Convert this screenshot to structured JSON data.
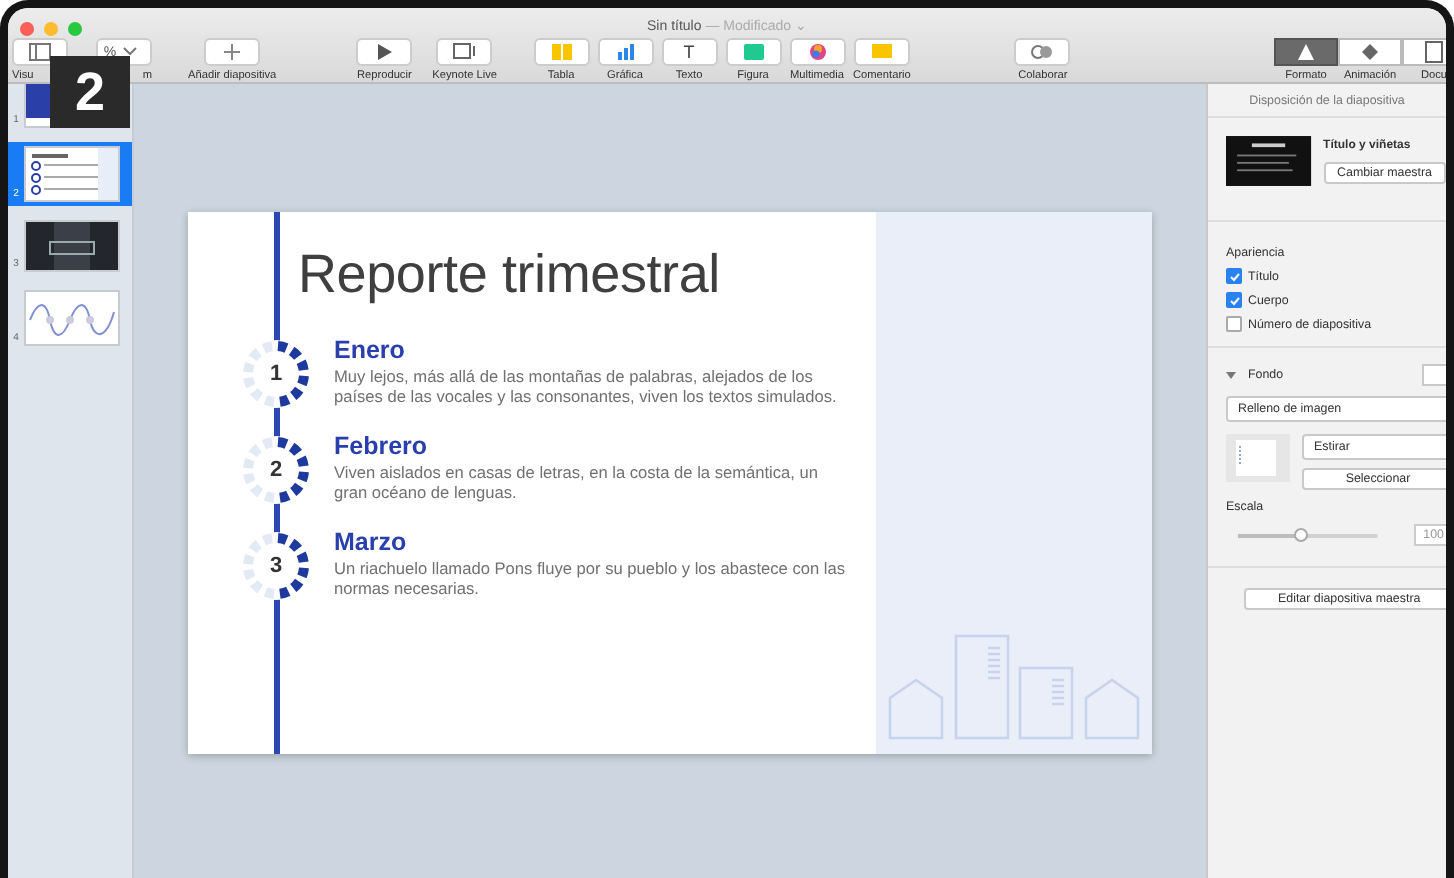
{
  "window": {
    "title": "Sin título",
    "status": "— Modificado ⌄"
  },
  "step_badge": "2",
  "toolbar": {
    "groups": [
      {
        "items": [
          {
            "kind": "view",
            "label": "Visu"
          },
          {
            "kind": "zoom",
            "label": "m",
            "value": "%"
          },
          {
            "kind": "add",
            "label": "Añadir diapositiva"
          }
        ]
      },
      {
        "items": [
          {
            "kind": "play",
            "label": "Reproducir"
          },
          {
            "kind": "live",
            "label": "Keynote Live"
          }
        ]
      },
      {
        "items": [
          {
            "kind": "table",
            "label": "Tabla"
          },
          {
            "kind": "chart",
            "label": "Gráfica"
          },
          {
            "kind": "text",
            "label": "Texto",
            "glyph": "T"
          },
          {
            "kind": "shape",
            "label": "Figura"
          },
          {
            "kind": "media",
            "label": "Multimedia"
          },
          {
            "kind": "comment",
            "label": "Comentario"
          }
        ]
      },
      {
        "items": [
          {
            "kind": "collab",
            "label": "Colaborar"
          }
        ]
      }
    ],
    "tabs": [
      {
        "kind": "format",
        "label": "Formato",
        "selected": true
      },
      {
        "kind": "animate",
        "label": "Animación",
        "selected": false
      },
      {
        "kind": "document",
        "label": "Docu",
        "selected": false
      }
    ]
  },
  "navigator": {
    "slides": [
      {
        "number": "1",
        "kind": "title",
        "selected": false
      },
      {
        "number": "2",
        "kind": "bullets",
        "selected": true
      },
      {
        "number": "3",
        "kind": "photo",
        "selected": false
      },
      {
        "number": "4",
        "kind": "wave",
        "selected": false
      }
    ]
  },
  "slide": {
    "title": "Reporte trimestral",
    "items": [
      {
        "number": "1",
        "heading": "Enero",
        "body": "Muy lejos, más allá de las montañas de palabras, alejados de los países de las vocales y las consonantes, viven los textos simulados."
      },
      {
        "number": "2",
        "heading": "Febrero",
        "body": "Viven aislados en casas de letras, en la costa de la semántica, un gran océano de lenguas."
      },
      {
        "number": "3",
        "heading": "Marzo",
        "body": "Un riachuelo llamado Pons fluye por su pueblo y los abastece con las normas necesarias."
      }
    ]
  },
  "inspector": {
    "header": "Disposición de la diapositiva",
    "master": {
      "name": "Título y viñetas",
      "button": "Cambiar maestra"
    },
    "appearance": {
      "label": "Apariencia",
      "checks": [
        {
          "label": "Título",
          "checked": true
        },
        {
          "label": "Cuerpo",
          "checked": true
        },
        {
          "label": "Número de diapositiva",
          "checked": false
        }
      ]
    },
    "background": {
      "label": "Fondo",
      "expanded": true,
      "fill": "Relleno de imagen",
      "mode": "Estirar",
      "choose": "Seleccionar",
      "scale": {
        "label": "Escala",
        "level": 0.45,
        "value": "100"
      }
    },
    "edit_button": "Editar diapositiva maestra"
  }
}
